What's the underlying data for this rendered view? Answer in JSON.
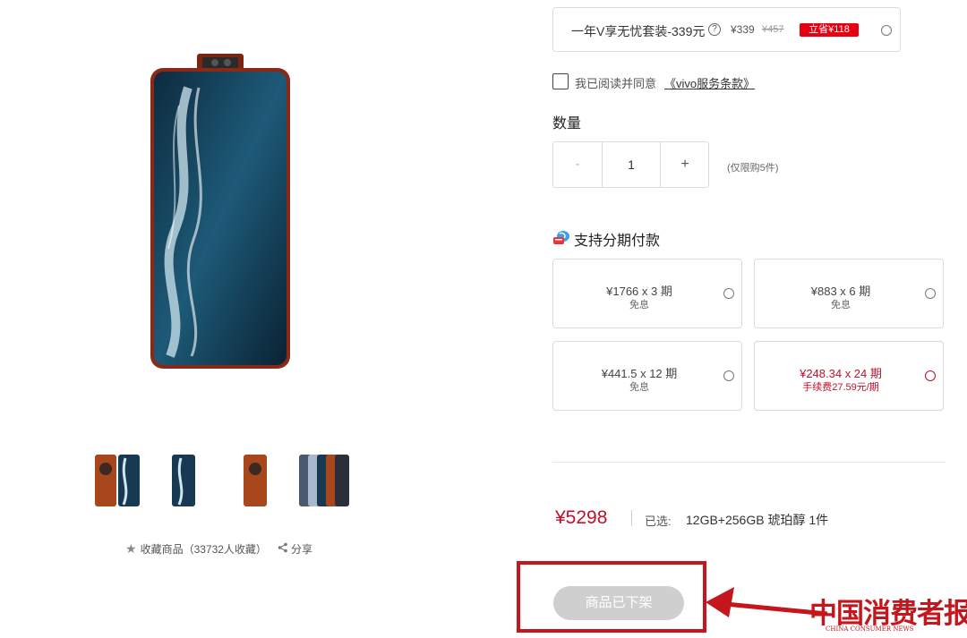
{
  "gallery": {
    "favorite_label": "收藏商品（33732人收藏）",
    "share_label": "分享",
    "thumbnail_count": 4
  },
  "bundle": {
    "name": "一年V享无忧套装-339元",
    "help_symbol": "?",
    "price": "¥339",
    "original_price": "¥457",
    "badge": "立省¥118"
  },
  "agreement": {
    "text": "我已阅读并同意",
    "link": "《vivo服务条款》"
  },
  "quantity": {
    "title": "数量",
    "minus": "-",
    "value": "1",
    "plus": "+",
    "limit": "(仅限购5件)"
  },
  "installment": {
    "title": "支持分期付款",
    "plans": [
      {
        "amount": "¥1766 x 3 期",
        "fee": "免息",
        "selected": false
      },
      {
        "amount": "¥883 x 6 期",
        "fee": "免息",
        "selected": false
      },
      {
        "amount": "¥441.5 x 12 期",
        "fee": "免息",
        "selected": false
      },
      {
        "amount": "¥248.34 x 24 期",
        "fee": "手续费27.59元/期",
        "selected": true
      }
    ]
  },
  "summary": {
    "price": "¥5298",
    "selected_label": "已选:",
    "selected_value": "12GB+256GB 琥珀醇 1件"
  },
  "purchase": {
    "button_label": "商品已下架"
  },
  "watermark": {
    "main": "中国消费者报",
    "sub": "CHINA CONSUMER NEWS"
  },
  "colors": {
    "brand_red": "#c0102b",
    "badge_red": "#e60012",
    "annotation_red": "#c4161c",
    "disabled_button": "#cfcfcf"
  }
}
